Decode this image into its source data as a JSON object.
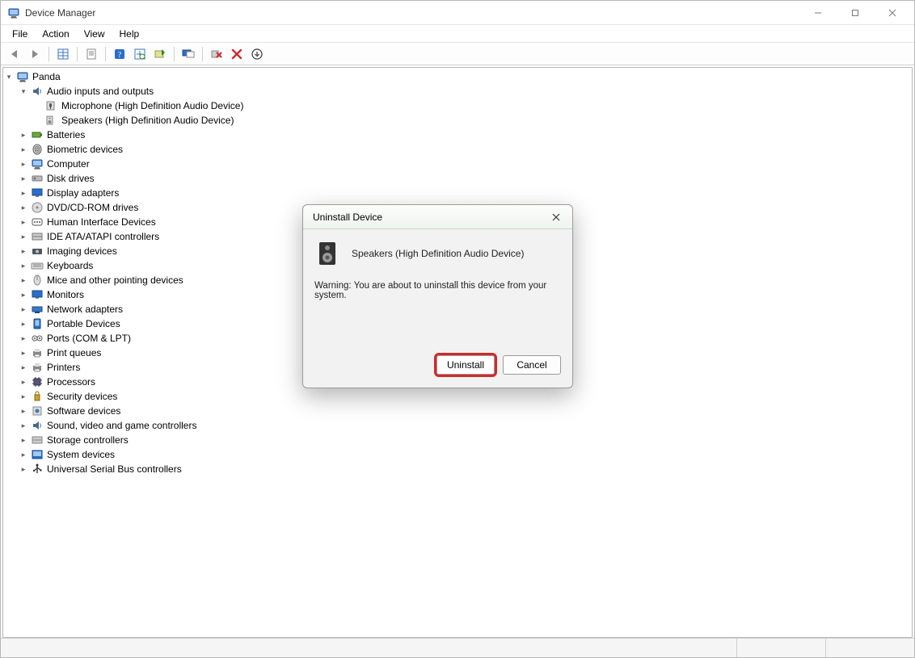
{
  "titlebar": {
    "title": "Device Manager"
  },
  "menu": {
    "file": "File",
    "action": "Action",
    "view": "View",
    "help": "Help"
  },
  "tree": {
    "root": "Panda",
    "audio_cat": "Audio inputs and outputs",
    "audio_children": [
      "Microphone (High Definition Audio Device)",
      "Speakers (High Definition Audio Device)"
    ],
    "categories": [
      "Batteries",
      "Biometric devices",
      "Computer",
      "Disk drives",
      "Display adapters",
      "DVD/CD-ROM drives",
      "Human Interface Devices",
      "IDE ATA/ATAPI controllers",
      "Imaging devices",
      "Keyboards",
      "Mice and other pointing devices",
      "Monitors",
      "Network adapters",
      "Portable Devices",
      "Ports (COM & LPT)",
      "Print queues",
      "Printers",
      "Processors",
      "Security devices",
      "Software devices",
      "Sound, video and game controllers",
      "Storage controllers",
      "System devices",
      "Universal Serial Bus controllers"
    ]
  },
  "dialog": {
    "title": "Uninstall Device",
    "device": "Speakers (High Definition Audio Device)",
    "warning": "Warning: You are about to uninstall this device from your system.",
    "uninstall": "Uninstall",
    "cancel": "Cancel"
  }
}
